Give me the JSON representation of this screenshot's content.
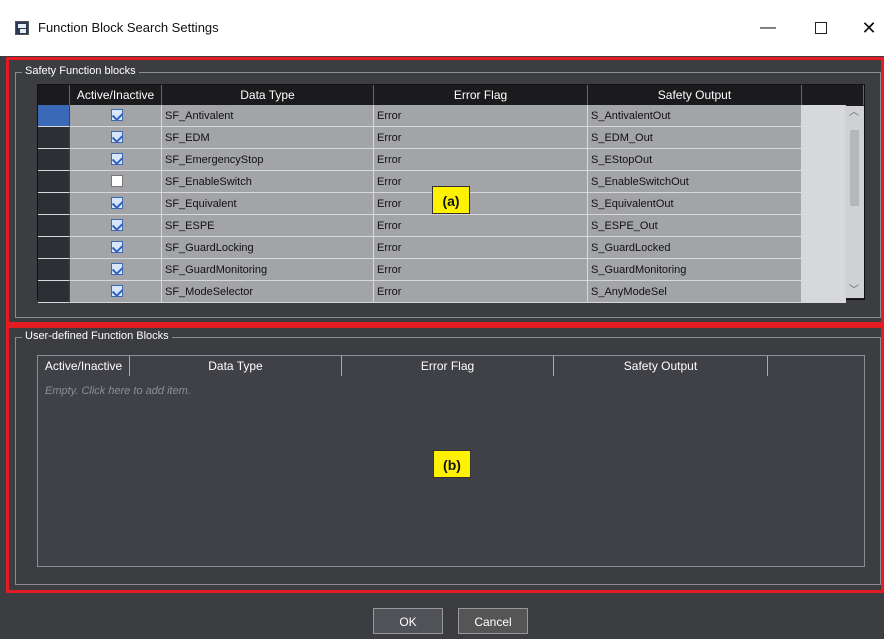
{
  "window": {
    "title": "Function Block Search Settings",
    "minimize_label": "—",
    "close_label": "✕"
  },
  "safety": {
    "group_label": "Safety Function blocks",
    "columns": [
      "Active/Inactive",
      "Data Type",
      "Error Flag",
      "Safety Output"
    ],
    "rows": [
      {
        "active": true,
        "data_type": "SF_Antivalent",
        "error_flag": "Error",
        "safety_output": "S_AntivalentOut"
      },
      {
        "active": true,
        "data_type": "SF_EDM",
        "error_flag": "Error",
        "safety_output": "S_EDM_Out"
      },
      {
        "active": true,
        "data_type": "SF_EmergencyStop",
        "error_flag": "Error",
        "safety_output": "S_EStopOut"
      },
      {
        "active": false,
        "data_type": "SF_EnableSwitch",
        "error_flag": "Error",
        "safety_output": "S_EnableSwitchOut"
      },
      {
        "active": true,
        "data_type": "SF_Equivalent",
        "error_flag": "Error",
        "safety_output": "S_EquivalentOut"
      },
      {
        "active": true,
        "data_type": "SF_ESPE",
        "error_flag": "Error",
        "safety_output": "S_ESPE_Out"
      },
      {
        "active": true,
        "data_type": "SF_GuardLocking",
        "error_flag": "Error",
        "safety_output": "S_GuardLocked"
      },
      {
        "active": true,
        "data_type": "SF_GuardMonitoring",
        "error_flag": "Error",
        "safety_output": "S_GuardMonitoring"
      },
      {
        "active": true,
        "data_type": "SF_ModeSelector",
        "error_flag": "Error",
        "safety_output": "S_AnyModeSel"
      }
    ]
  },
  "user": {
    "group_label": "User-defined Function Blocks",
    "columns": [
      "Active/Inactive",
      "Data Type",
      "Error Flag",
      "Safety Output"
    ],
    "empty_text": "Empty. Click here to add item."
  },
  "annotations": {
    "a": "(a)",
    "b": "(b)"
  },
  "buttons": {
    "ok": "OK",
    "cancel": "Cancel"
  },
  "colors": {
    "highlight_border": "#e31b23",
    "callout": "#fff200",
    "dialog_bg": "#3c3d41"
  }
}
